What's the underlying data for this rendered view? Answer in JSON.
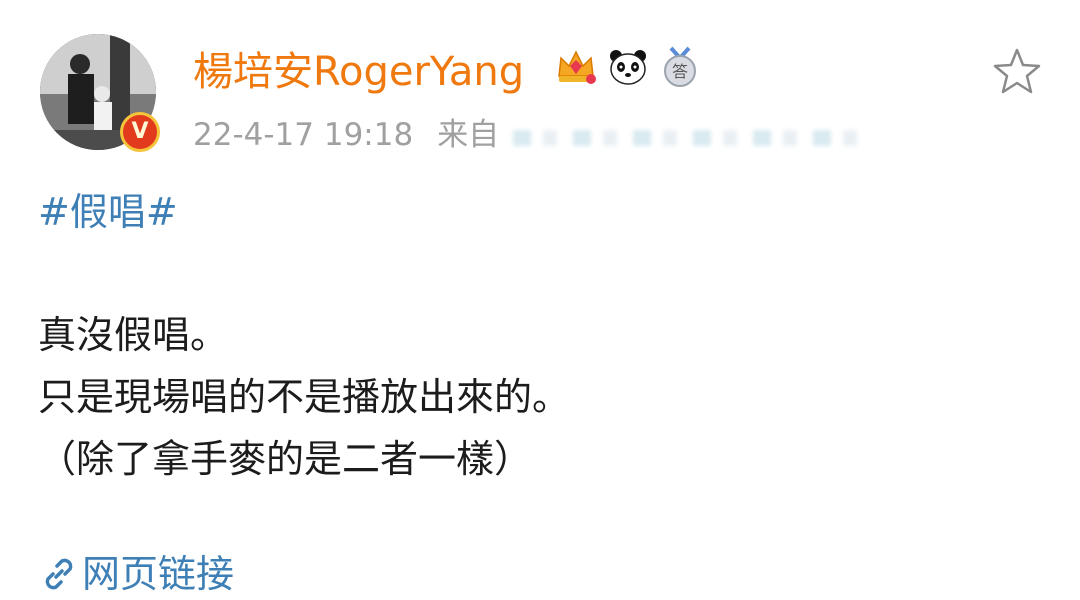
{
  "post": {
    "username": "楊培安RogerYang",
    "badges": [
      "crown-badge-icon",
      "panda-badge-icon",
      "answer-medal-icon"
    ],
    "answer_badge_char": "答",
    "verified_char": "V",
    "timestamp": "22-4-17 19:18",
    "source_label": "来自",
    "topic": "#假唱#",
    "lines": [
      "真沒假唱。",
      "只是現場唱的不是播放出來的。",
      "（除了拿手麥的是二者一樣）"
    ],
    "link_label": "网页链接"
  },
  "colors": {
    "username": "#f0790f",
    "link": "#3e7fb5",
    "meta": "#a0a0a0",
    "verified": "#e23a1d"
  }
}
